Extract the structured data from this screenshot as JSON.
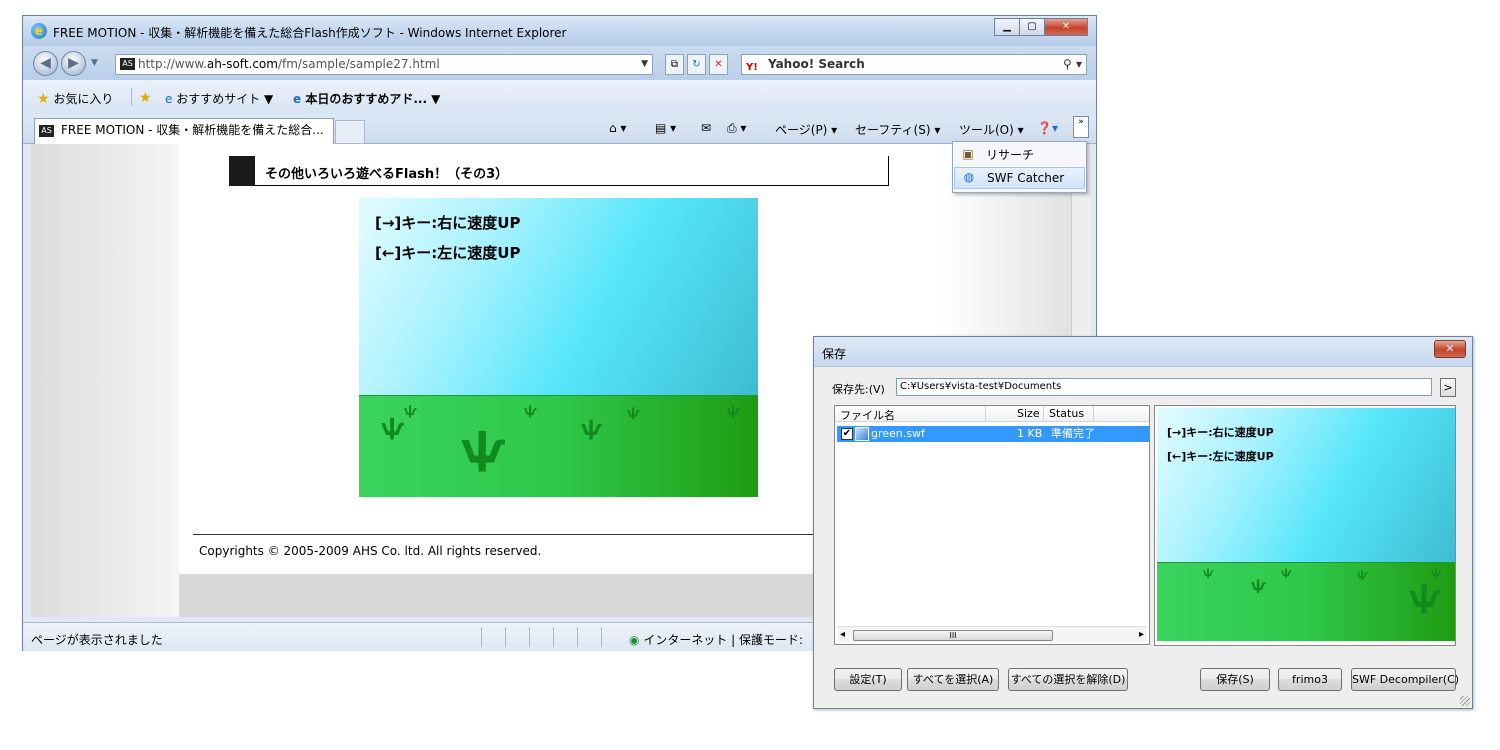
{
  "ie": {
    "title": "FREE MOTION - 収集・解析機能を備えた総合Flash作成ソフト - Windows Internet Explorer",
    "url_prefix": "http://www.",
    "url_domain": "ah-soft.com",
    "url_path": "/fm/sample/sample27.html",
    "search_label": "Yahoo! Search",
    "favorites": "お気に入り",
    "suggested_sites": "おすすめサイト ▼",
    "recommend_addon": "本日のおすすめアド... ▼",
    "tab_title": "FREE MOTION - 収集・解析機能を備えた総合...",
    "cmd_page": "ページ(P) ▾",
    "cmd_safety": "セーフティ(S) ▾",
    "cmd_tools": "ツール(O) ▾",
    "status_text": "ページが表示されました",
    "status_zone": "インターネット | 保護モード:"
  },
  "tools_menu": {
    "items": [
      "リサーチ",
      "SWF Catcher"
    ]
  },
  "page": {
    "heading": "その他いろいろ遊べるFlash！（その3）",
    "flash_line1": "[→]キー:右に速度UP",
    "flash_line2": "[←]キー:左に速度UP",
    "footer": "Copyrights © 2005-2009 AHS Co. ltd. All rights reserved."
  },
  "dialog": {
    "title": "保存",
    "path_label": "保存先:(V)",
    "path_value": "C:¥Users¥vista-test¥Documents",
    "browse_label": ">",
    "columns": [
      "ファイル名",
      "Size",
      "Status"
    ],
    "rows": [
      {
        "name": "green.swf",
        "size": "1 KB",
        "status": "準備完了",
        "checked": true
      }
    ],
    "scroll_grip": "III",
    "buttons": {
      "settings": "設定(T)",
      "select_all": "すべてを選択(A)",
      "deselect_all": "すべての選択を解除(D)",
      "save": "保存(S)",
      "frimo3": "frimo3",
      "decompiler": "SWF Decompiler(C)"
    }
  },
  "colors": {
    "accent_selection": "#3399ff",
    "grass": "#2fc84a",
    "sky": "#55e6fa"
  }
}
